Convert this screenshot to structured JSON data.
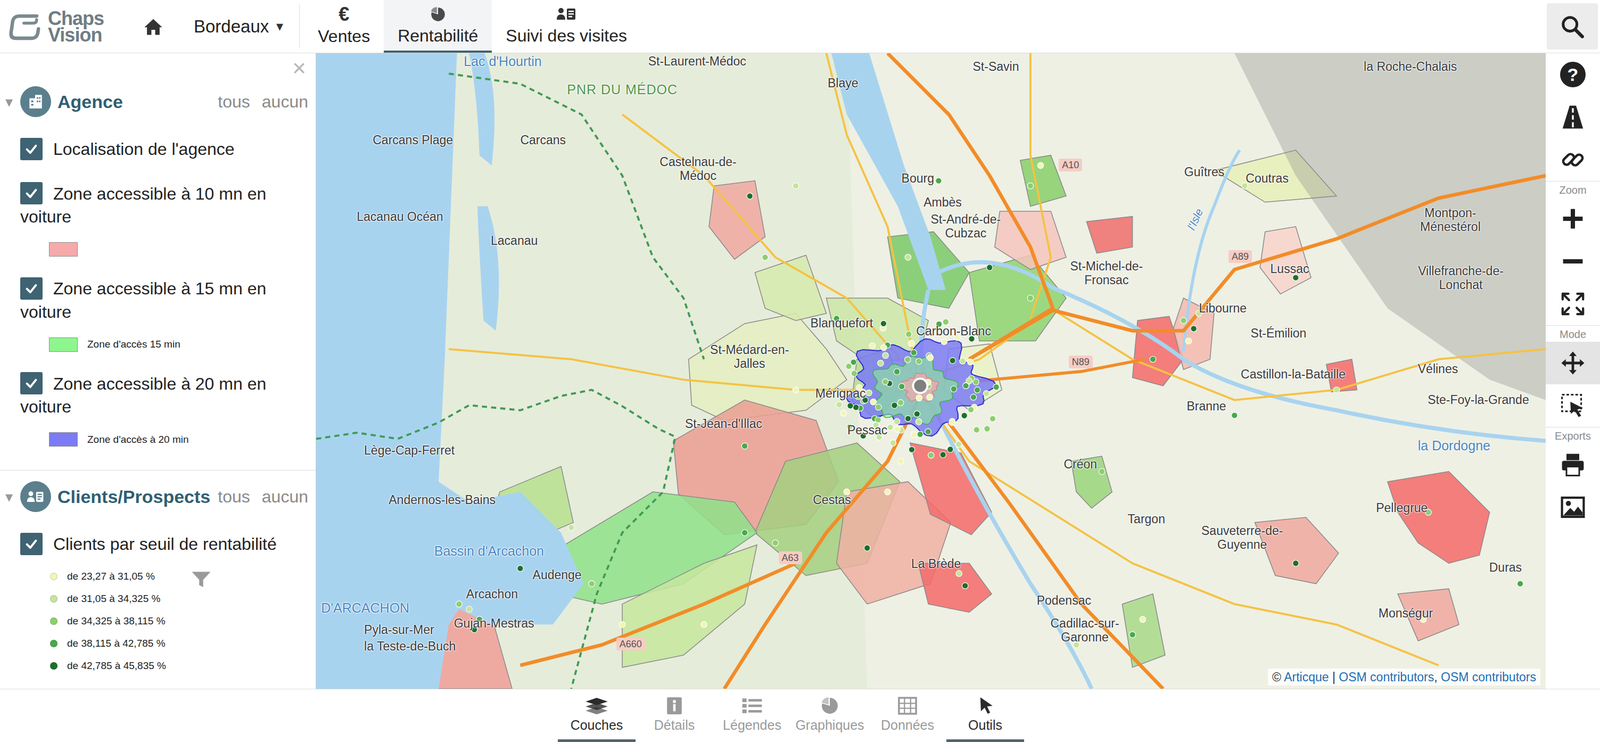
{
  "header": {
    "logo_lines": [
      "Chaps",
      "Vision"
    ],
    "city": "Bordeaux",
    "city_caret": "▾",
    "tabs": [
      {
        "label": "Ventes",
        "kind": "glyph",
        "glyph": "€",
        "selected": false
      },
      {
        "label": "Rentabilité",
        "kind": "pie",
        "selected": true
      },
      {
        "label": "Suivi des visites",
        "kind": "visits",
        "selected": false
      }
    ]
  },
  "panel": {
    "close": "×",
    "groups": [
      {
        "title": "Agence",
        "kind": "agency",
        "caret": "▾",
        "expanded": true,
        "all": "tous",
        "none": "aucun",
        "layers": [
          {
            "label": "Localisation de l'agence",
            "checked": true,
            "filterable": false,
            "legend": []
          },
          {
            "label": "Zone accessible à 10 mn en voiture",
            "checked": true,
            "filterable": false,
            "legend": [
              {
                "kind": "swatch",
                "color": "#f6a9a9"
              }
            ]
          },
          {
            "label": "Zone accessible à 15 mn en voiture",
            "checked": true,
            "filterable": false,
            "legend": [
              {
                "kind": "swatch",
                "color": "#8ff58f",
                "label": "Zone d'accès 15 min"
              }
            ]
          },
          {
            "label": "Zone accessible à 20 mn en voiture",
            "checked": true,
            "filterable": false,
            "legend": [
              {
                "kind": "swatch",
                "color": "#7b7bf5",
                "label": "Zone d'accès à 20 min"
              }
            ]
          }
        ]
      },
      {
        "title": "Clients/Prospects",
        "kind": "clients",
        "caret": "▾",
        "expanded": true,
        "all": "tous",
        "none": "aucun",
        "layers": [
          {
            "label": "Clients par seuil de rentabilité",
            "checked": true,
            "filterable": true,
            "legend": [
              {
                "kind": "dot",
                "color": "#f2f5b8",
                "label": "de 23,27 à 31,05 %"
              },
              {
                "kind": "dot",
                "color": "#c4e59a",
                "label": "de 31,05 à 34,325 %"
              },
              {
                "kind": "dot",
                "color": "#8ccf6e",
                "label": "de 34,325 à 38,115 %"
              },
              {
                "kind": "dot",
                "color": "#49a84c",
                "label": "de 38,115 à 42,785 %"
              },
              {
                "kind": "dot",
                "color": "#1c6f2c",
                "label": "de 42,785 à 45,835 %"
              }
            ]
          }
        ]
      }
    ]
  },
  "map": {
    "places": [
      {
        "name": "Lac d'Hourtin",
        "kind": "water"
      },
      {
        "name": "PNR DU MÉDOC",
        "kind": "park"
      },
      {
        "name": "St-Laurent-Médoc",
        "kind": "town"
      },
      {
        "name": "Blaye",
        "kind": "town"
      },
      {
        "name": "St-Savin",
        "kind": "town"
      },
      {
        "name": "la Roche-Chalais",
        "kind": "town"
      },
      {
        "name": "Carcans Plage",
        "kind": "town"
      },
      {
        "name": "Carcans",
        "kind": "town"
      },
      {
        "name": "Castelnau-de-Médoc",
        "kind": "town"
      },
      {
        "name": "Bourg",
        "kind": "town"
      },
      {
        "name": "Ambès",
        "kind": "town"
      },
      {
        "name": "St-André-de-Cubzac",
        "kind": "town"
      },
      {
        "name": "Guîtres",
        "kind": "town"
      },
      {
        "name": "Coutras",
        "kind": "town"
      },
      {
        "name": "Lacanau Océan",
        "kind": "town"
      },
      {
        "name": "Lacanau",
        "kind": "town"
      },
      {
        "name": "St-Michel-de-Fronsac",
        "kind": "town"
      },
      {
        "name": "Libourne",
        "kind": "town"
      },
      {
        "name": "Lussac",
        "kind": "town"
      },
      {
        "name": "Montpon-Ménestérol",
        "kind": "town"
      },
      {
        "name": "Villefranche-de-Lonchat",
        "kind": "town"
      },
      {
        "name": "Blanquefort",
        "kind": "town"
      },
      {
        "name": "Carbon-Blanc",
        "kind": "town"
      },
      {
        "name": "St-Médard-en-Jalles",
        "kind": "town"
      },
      {
        "name": "Mérignac",
        "kind": "town"
      },
      {
        "name": "St-Émilion",
        "kind": "town"
      },
      {
        "name": "Castillon-la-Bataille",
        "kind": "town"
      },
      {
        "name": "Vélines",
        "kind": "town"
      },
      {
        "name": "Ste-Foy-la-Grande",
        "kind": "town"
      },
      {
        "name": "Lège-Cap-Ferret",
        "kind": "town"
      },
      {
        "name": "St-Jean-d'Illac",
        "kind": "town"
      },
      {
        "name": "Pessac",
        "kind": "town"
      },
      {
        "name": "Branne",
        "kind": "town"
      },
      {
        "name": "la Dordogne",
        "kind": "water"
      },
      {
        "name": "Créon",
        "kind": "town"
      },
      {
        "name": "Andernos-les-Bains",
        "kind": "town"
      },
      {
        "name": "Targon",
        "kind": "town"
      },
      {
        "name": "Pellegrue",
        "kind": "town"
      },
      {
        "name": "Bassin d'Arcachon",
        "kind": "water"
      },
      {
        "name": "Cestas",
        "kind": "town"
      },
      {
        "name": "Sauveterre-de-Guyenne",
        "kind": "town"
      },
      {
        "name": "Audenge",
        "kind": "town"
      },
      {
        "name": "Arcachon",
        "kind": "town"
      },
      {
        "name": "Gujan-Mestras",
        "kind": "town"
      },
      {
        "name": "Pyla-sur-Mer",
        "kind": "town"
      },
      {
        "name": "la Teste-de-Buch",
        "kind": "town"
      },
      {
        "name": "D'ARCACHON",
        "kind": "water"
      },
      {
        "name": "La Brède",
        "kind": "town"
      },
      {
        "name": "Podensac",
        "kind": "town"
      },
      {
        "name": "Cadillac-sur-Garonne",
        "kind": "town"
      },
      {
        "name": "Monségur",
        "kind": "town"
      },
      {
        "name": "Duras",
        "kind": "town"
      },
      {
        "name": "A10",
        "kind": "road"
      },
      {
        "name": "A89",
        "kind": "road"
      },
      {
        "name": "N89",
        "kind": "road"
      },
      {
        "name": "A63",
        "kind": "road"
      },
      {
        "name": "A660",
        "kind": "road"
      },
      {
        "name": "l'Isle",
        "kind": "river"
      }
    ],
    "attribution": [
      {
        "text": "© ",
        "link": false
      },
      {
        "text": "Articque",
        "link": true
      },
      {
        "text": " | ",
        "link": false
      },
      {
        "text": "OSM contributors",
        "link": true
      },
      {
        "text": ", ",
        "link": false
      },
      {
        "text": "OSM contributors",
        "link": true
      }
    ]
  },
  "toolbar": {
    "help": "?",
    "sections": [
      {
        "label": "Zoom"
      },
      {
        "label": "Mode"
      },
      {
        "label": "Exports"
      }
    ],
    "modes": [
      {
        "selected": true
      },
      {
        "selected": false
      }
    ]
  },
  "bottom_tabs": [
    {
      "label": "Couches",
      "selected": true,
      "disabled": false
    },
    {
      "label": "Détails",
      "selected": false,
      "disabled": true
    },
    {
      "label": "Légendes",
      "selected": false,
      "disabled": true
    },
    {
      "label": "Graphiques",
      "selected": false,
      "disabled": true
    },
    {
      "label": "Données",
      "selected": false,
      "disabled": true
    },
    {
      "label": "Outils",
      "selected": true,
      "disabled": false
    }
  ]
}
